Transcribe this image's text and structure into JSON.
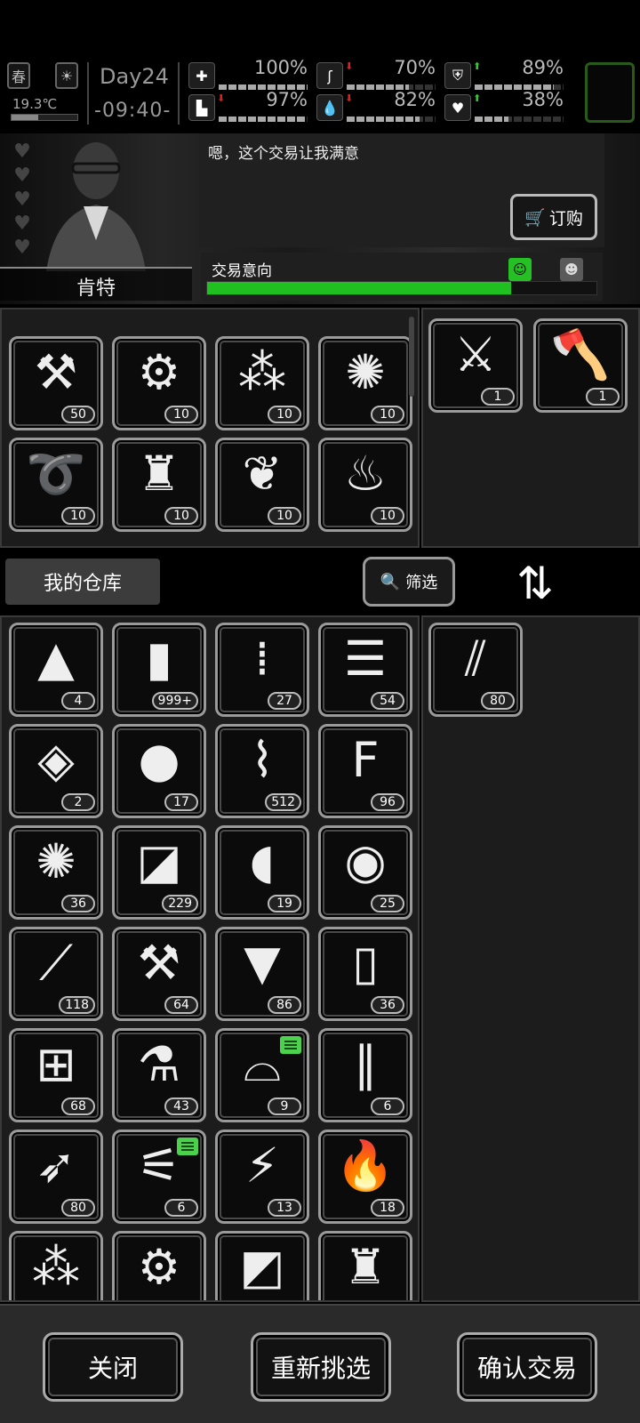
{
  "status": {
    "season": "春",
    "temperature": "19.3℃",
    "temperature_level": 0.4,
    "day": "Day24",
    "time": "-09:40-",
    "stats": [
      {
        "icon": "medkit-icon",
        "value": "100%",
        "level": 1.0,
        "trend": "none"
      },
      {
        "icon": "stomach-icon",
        "value": "70%",
        "level": 0.7,
        "trend": "down"
      },
      {
        "icon": "shield-icon",
        "value": "89%",
        "level": 0.89,
        "trend": "up"
      },
      {
        "icon": "boot-icon",
        "value": "97%",
        "level": 0.97,
        "trend": "down"
      },
      {
        "icon": "water-drop-icon",
        "value": "82%",
        "level": 0.82,
        "trend": "down"
      },
      {
        "icon": "heart-icon",
        "value": "38%",
        "level": 0.38,
        "trend": "up"
      }
    ]
  },
  "npc": {
    "name": "肯特",
    "hearts": 5,
    "dialog": "嗯，这个交易让我满意",
    "order_label": "订购",
    "intent_label": "交易意向",
    "intent_level": 0.78
  },
  "npc_stock": [
    {
      "icon": "nails-icon",
      "glyph": "⚒",
      "count": "50"
    },
    {
      "icon": "gears-icon",
      "glyph": "⚙",
      "count": "10"
    },
    {
      "icon": "rubble-icon",
      "glyph": "⁂",
      "count": "10"
    },
    {
      "icon": "fur-ball-icon",
      "glyph": "✺",
      "count": "10"
    },
    {
      "icon": "rope-icon",
      "glyph": "➰",
      "count": "10"
    },
    {
      "icon": "spray-bottle-icon",
      "glyph": "♜",
      "count": "10"
    },
    {
      "icon": "seeds-icon",
      "glyph": "❦",
      "count": "10"
    },
    {
      "icon": "tool-pouch-icon",
      "glyph": "♨",
      "count": "10"
    }
  ],
  "npc_offer": [
    {
      "icon": "machete-icon",
      "glyph": "⚔",
      "count": "1"
    },
    {
      "icon": "axe-icon",
      "glyph": "🪓",
      "count": "1"
    }
  ],
  "middle": {
    "warehouse_tab": "我的仓库",
    "filter_label": "筛选"
  },
  "my_stock": [
    {
      "icon": "torn-cloth-icon",
      "glyph": "▲",
      "count": "4"
    },
    {
      "icon": "battery-pack-icon",
      "glyph": "▮",
      "count": "999+"
    },
    {
      "icon": "bullets-icon",
      "glyph": "⁞",
      "count": "27"
    },
    {
      "icon": "folded-cloth-icon",
      "glyph": "☰",
      "count": "54"
    },
    {
      "icon": "animal-hide-icon",
      "glyph": "◈",
      "count": "2"
    },
    {
      "icon": "raw-meat-icon",
      "glyph": "●",
      "count": "17"
    },
    {
      "icon": "scrap-metal-icon",
      "glyph": "⌇",
      "count": "512"
    },
    {
      "icon": "flour-sack-icon",
      "glyph": "F",
      "count": "96"
    },
    {
      "icon": "fur-ball-icon",
      "glyph": "✺",
      "count": "36"
    },
    {
      "icon": "paper-sheets-icon",
      "glyph": "◪",
      "count": "229"
    },
    {
      "icon": "stones-icon",
      "glyph": "◖",
      "count": "19"
    },
    {
      "icon": "cans-icon",
      "glyph": "◉",
      "count": "25"
    },
    {
      "icon": "lockpick-icon",
      "glyph": "⟋",
      "count": "118"
    },
    {
      "icon": "nails-icon",
      "glyph": "⚒",
      "count": "64"
    },
    {
      "icon": "bucket-icon",
      "glyph": "▼",
      "count": "86"
    },
    {
      "icon": "bottle-icon",
      "glyph": "▯",
      "count": "36"
    },
    {
      "icon": "mesh-filter-icon",
      "glyph": "⊞",
      "count": "68"
    },
    {
      "icon": "flask-icon",
      "glyph": "⚗",
      "count": "43"
    },
    {
      "icon": "towel-icon",
      "glyph": "⌓",
      "count": "9",
      "badge": true
    },
    {
      "icon": "tubes-icon",
      "glyph": "∥",
      "count": "6"
    },
    {
      "icon": "arrow-icon",
      "glyph": "➶",
      "count": "80"
    },
    {
      "icon": "wires-icon",
      "glyph": "⚟",
      "count": "6",
      "badge": true
    },
    {
      "icon": "batteries-icon",
      "glyph": "⚡",
      "count": "13"
    },
    {
      "icon": "fuel-barrel-icon",
      "glyph": "🔥",
      "count": "18"
    },
    {
      "icon": "rubble-icon",
      "glyph": "⁂",
      "count": ""
    },
    {
      "icon": "gears-icon",
      "glyph": "⚙",
      "count": ""
    },
    {
      "icon": "cloth-icon",
      "glyph": "◩",
      "count": ""
    },
    {
      "icon": "spray-bottle-icon",
      "glyph": "♜",
      "count": ""
    }
  ],
  "my_offer": [
    {
      "icon": "skewers-icon",
      "glyph": "⫽",
      "count": "80"
    }
  ],
  "bottom": {
    "close_label": "关闭",
    "reselect_label": "重新挑选",
    "confirm_label": "确认交易"
  }
}
